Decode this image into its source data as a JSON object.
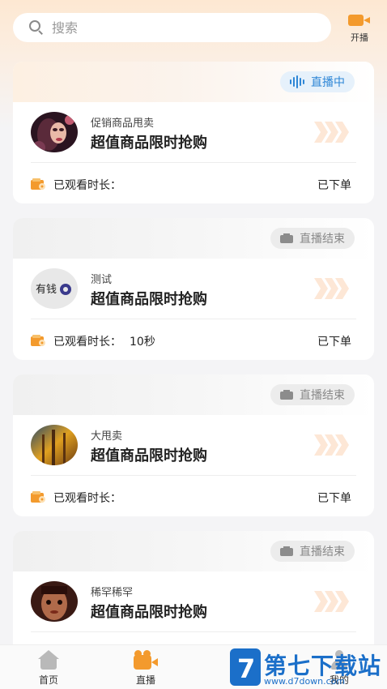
{
  "search": {
    "placeholder": "搜索"
  },
  "go_live": {
    "label": "开播"
  },
  "cards": [
    {
      "status": "直播中",
      "shop": "促销商品甩卖",
      "title": "超值商品限时抢购",
      "watch_label": "已观看时长：",
      "duration": "",
      "order_label": "已下单"
    },
    {
      "status": "直播结束",
      "shop": "测试",
      "title": "超值商品限时抢购",
      "watch_label": "已观看时长：",
      "duration": "10秒",
      "order_label": "已下单"
    },
    {
      "status": "直播结束",
      "shop": "大甩卖",
      "title": "超值商品限时抢购",
      "watch_label": "已观看时长：",
      "duration": "",
      "order_label": "已下单"
    },
    {
      "status": "直播结束",
      "shop": "稀罕稀罕",
      "title": "超值商品限时抢购",
      "watch_label": "",
      "duration": "",
      "order_label": ""
    }
  ],
  "avatar2_text": "有钱",
  "tabs": [
    {
      "label": "首页",
      "icon": "home-icon"
    },
    {
      "label": "直播",
      "icon": "live-icon"
    },
    {
      "label": "我的",
      "icon": "profile-icon"
    }
  ],
  "watermark": {
    "text": "第七下载站",
    "url": "www.d7down.com"
  },
  "colors": {
    "accent": "#f39a2d",
    "live_badge": "#2e86d6",
    "ended_badge": "#888888"
  }
}
